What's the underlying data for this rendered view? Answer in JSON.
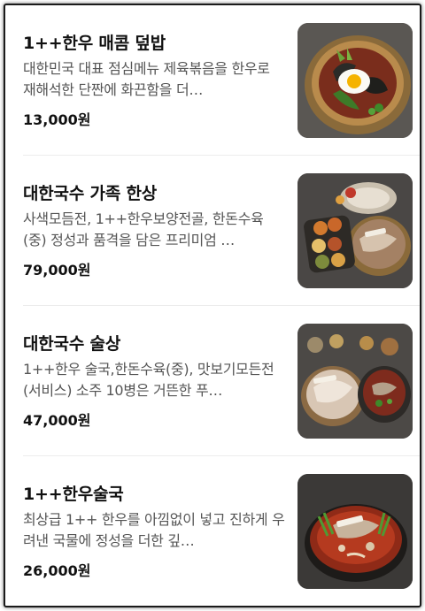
{
  "menu": {
    "items": [
      {
        "name": "1++한우 매콤 덮밥",
        "description": "대한민국 대표 점심메뉴 제육볶음을 한우로 재해석한 단짠에 화끈함을 더…",
        "price": "13,000원",
        "image_icon": "spicy-beef-bibimbap-photo"
      },
      {
        "name": "대한국수 가족 한상",
        "description": "사색모듬전, 1++한우보양전골, 한돈수육(중) 정성과 품격을 담은 프리미엄 …",
        "price": "79,000원",
        "image_icon": "family-set-platter-photo"
      },
      {
        "name": "대한국수 술상",
        "description": "1++한우 술국,한돈수육(중), 맛보기모든전(서비스) 소주 10병은 거뜬한 푸…",
        "price": "47,000원",
        "image_icon": "drinking-set-platter-photo"
      },
      {
        "name": "1++한우술국",
        "description": "최상급 1++ 한우를 아낌없이 넣고 진하게 우려낸 국물에 정성을 더한 깊…",
        "price": "26,000원",
        "image_icon": "beef-hangover-soup-photo"
      }
    ]
  }
}
